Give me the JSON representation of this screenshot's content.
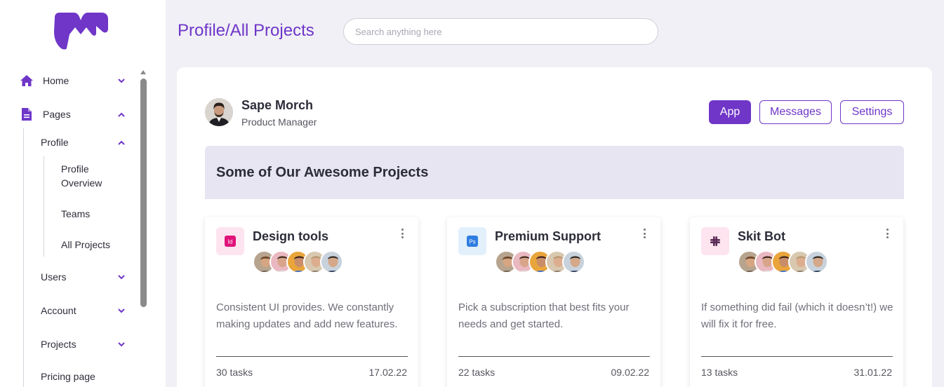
{
  "colors": {
    "accent": "#6f36c8",
    "banner_bg": "#e6e5f1",
    "page_bg": "#f0f0f6"
  },
  "sidebar": {
    "logo_icon": "m-logo",
    "items": [
      {
        "label": "Home",
        "icon": "home-icon",
        "expanded": false
      },
      {
        "label": "Pages",
        "icon": "document-icon",
        "expanded": true
      },
      {
        "label": "Profile",
        "expanded": true
      },
      {
        "label": "Profile Overview"
      },
      {
        "label": "Teams"
      },
      {
        "label": "All Projects"
      },
      {
        "label": "Users",
        "expanded": false
      },
      {
        "label": "Account",
        "expanded": false
      },
      {
        "label": "Projects",
        "expanded": false
      },
      {
        "label": "Pricing page"
      }
    ]
  },
  "header": {
    "title": "Profile/All Projects",
    "search_placeholder": "Search anything here"
  },
  "profile": {
    "name": "Sape Morch",
    "role": "Product Manager"
  },
  "actions": {
    "app": "App",
    "messages": "Messages",
    "settings": "Settings"
  },
  "banner": {
    "title": "Some of Our Awesome Projects"
  },
  "projects": [
    {
      "title": "Design tools",
      "icon": "indesign-icon",
      "icon_text": "Id",
      "icon_color": "#e0137a",
      "icon_bg": "#fde4ef",
      "description": "Consistent UI provides. We constantly making updates and add new features.",
      "tasks": "30 tasks",
      "date": "17.02.22"
    },
    {
      "title": "Premium Support",
      "icon": "photoshop-icon",
      "icon_text": "Ps",
      "icon_color": "#2f7de1",
      "icon_bg": "#e2f0fc",
      "description": "Pick a subscription that best fits your needs and get started.",
      "tasks": "22 tasks",
      "date": "09.02.22"
    },
    {
      "title": "Skit Bot",
      "icon": "slack-icon",
      "icon_text": "",
      "icon_color": "#5a2a55",
      "icon_bg": "#fde4ef",
      "description": "If something did fail (which it doesn’t!) we will fix it for free.",
      "tasks": "13 tasks",
      "date": "31.01.22"
    }
  ]
}
